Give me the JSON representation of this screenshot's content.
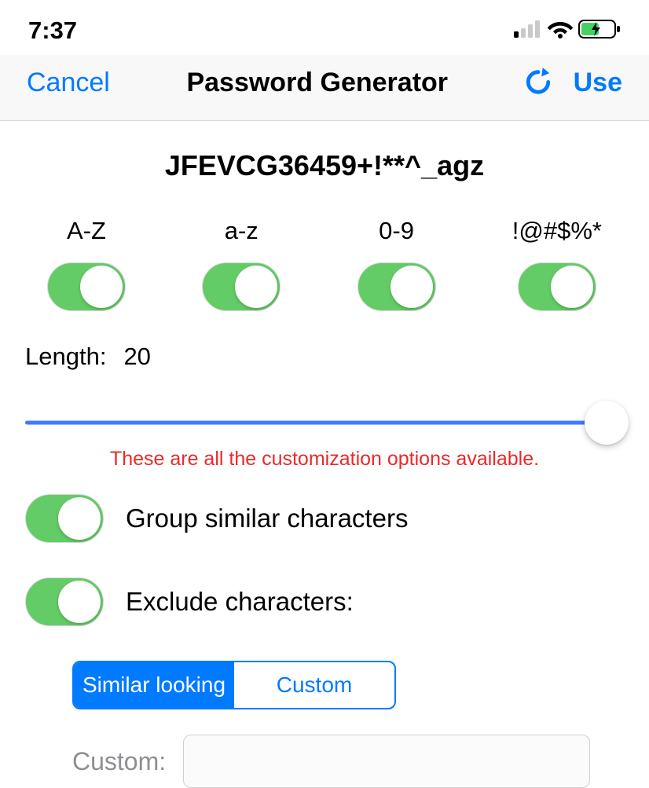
{
  "status_bar": {
    "time": "7:37"
  },
  "nav": {
    "cancel_label": "Cancel",
    "title": "Password Generator",
    "use_label": "Use"
  },
  "password": "JFEVCG36459+!**^_agz",
  "charsets": {
    "upper": {
      "label": "A-Z",
      "on": true
    },
    "lower": {
      "label": "a-z",
      "on": true
    },
    "digits": {
      "label": "0-9",
      "on": true
    },
    "symbols": {
      "label": "!@#$%*",
      "on": true
    }
  },
  "length": {
    "label": "Length:",
    "value": "20"
  },
  "annotation": "These are all the customization options available.",
  "options": {
    "group_similar": {
      "label": "Group similar characters",
      "on": true
    },
    "exclude": {
      "label": "Exclude characters:",
      "on": true
    }
  },
  "segmented": {
    "similar": "Similar looking",
    "custom": "Custom",
    "selected": "similar"
  },
  "custom": {
    "label": "Custom:",
    "value": ""
  }
}
